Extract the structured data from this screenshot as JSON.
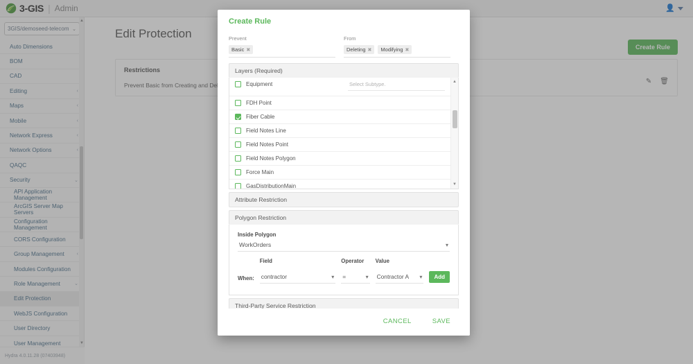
{
  "topbar": {
    "logo_text": "3-GIS",
    "logo_divider": "|",
    "logo_suffix": "Admin",
    "user_icon": "user-icon",
    "caret_icon": "chevron-down-icon"
  },
  "sidebar": {
    "env_select": {
      "value": "3GIS/demoseed-telecom",
      "caret": "⌄"
    },
    "items": [
      {
        "label": "Auto Dimensions",
        "chev": "",
        "active": false,
        "sub": false
      },
      {
        "label": "BOM",
        "chev": "",
        "active": false,
        "sub": false
      },
      {
        "label": "CAD",
        "chev": "",
        "active": false,
        "sub": false
      },
      {
        "label": "Editing",
        "chev": "‹",
        "active": false,
        "sub": false
      },
      {
        "label": "Maps",
        "chev": "‹",
        "active": false,
        "sub": false
      },
      {
        "label": "Mobile",
        "chev": "‹",
        "active": false,
        "sub": false
      },
      {
        "label": "Network Express",
        "chev": "‹",
        "active": false,
        "sub": false
      },
      {
        "label": "Network Options",
        "chev": "‹",
        "active": false,
        "sub": false
      },
      {
        "label": "QAQC",
        "chev": "",
        "active": false,
        "sub": false
      },
      {
        "label": "Security",
        "chev": "⌄",
        "active": false,
        "sub": false
      },
      {
        "label": "API Application Management",
        "chev": "",
        "active": false,
        "sub": true
      },
      {
        "label": "ArcGIS Server Map Servers",
        "chev": "",
        "active": false,
        "sub": true
      },
      {
        "label": "Configuration Management",
        "chev": "",
        "active": false,
        "sub": true
      },
      {
        "label": "CORS Configuration",
        "chev": "",
        "active": false,
        "sub": true
      },
      {
        "label": "Group Management",
        "chev": "‹",
        "active": false,
        "sub": true
      },
      {
        "label": "Modules Configuration",
        "chev": "",
        "active": false,
        "sub": true
      },
      {
        "label": "Role Management",
        "chev": "⌄",
        "active": false,
        "sub": true
      },
      {
        "label": "Edit Protection",
        "chev": "",
        "active": true,
        "sub": true
      },
      {
        "label": "WebJS Configuration",
        "chev": "",
        "active": false,
        "sub": true
      },
      {
        "label": "User Directory",
        "chev": "",
        "active": false,
        "sub": true
      },
      {
        "label": "User Management",
        "chev": "",
        "active": false,
        "sub": true
      }
    ],
    "footer_version": "Hydra 4.0.11.28 (07403948)"
  },
  "page": {
    "title": "Edit Protection",
    "create_rule_label": "Create Rule",
    "restrictions_heading": "Restrictions",
    "restriction_text": "Prevent Basic from Creating and Deleting and Modifying",
    "edit_icon": "pencil-icon",
    "delete_icon": "trash-icon"
  },
  "modal": {
    "title": "Create Rule",
    "prevent": {
      "label": "Prevent",
      "chips": [
        "Basic"
      ]
    },
    "from": {
      "label": "From",
      "chips": [
        "Deleting",
        "Modifying"
      ]
    },
    "layers_section": {
      "header": "Layers (Required)",
      "subtype_placeholder": "Select Subtype."
    },
    "layers": [
      {
        "name": "Equipment",
        "checked": false
      },
      {
        "name": "FDH Point",
        "checked": false
      },
      {
        "name": "Fiber Cable",
        "checked": true
      },
      {
        "name": "Field Notes Line",
        "checked": false
      },
      {
        "name": "Field Notes Point",
        "checked": false
      },
      {
        "name": "Field Notes Polygon",
        "checked": false
      },
      {
        "name": "Force Main",
        "checked": false
      },
      {
        "name": "GasDistributionMain",
        "checked": false
      }
    ],
    "attribute_section": {
      "header": "Attribute Restriction"
    },
    "polygon_section": {
      "header": "Polygon Restriction",
      "inside_polygon_label": "Inside Polygon",
      "inside_polygon_value": "WorkOrders",
      "when_label": "When:",
      "field_label": "Field",
      "field_value": "contractor",
      "operator_label": "Operator",
      "operator_value": "=",
      "value_label": "Value",
      "value_value": "Contractor A",
      "add_label": "Add"
    },
    "third_party_section": {
      "header": "Third-Party Service Restriction"
    },
    "cancel_label": "CANCEL",
    "save_label": "SAVE"
  },
  "colors": {
    "brand_green": "#5cb85c",
    "nav_link": "#4a6f8a",
    "overlay": "rgba(80,80,80,0.42)"
  }
}
